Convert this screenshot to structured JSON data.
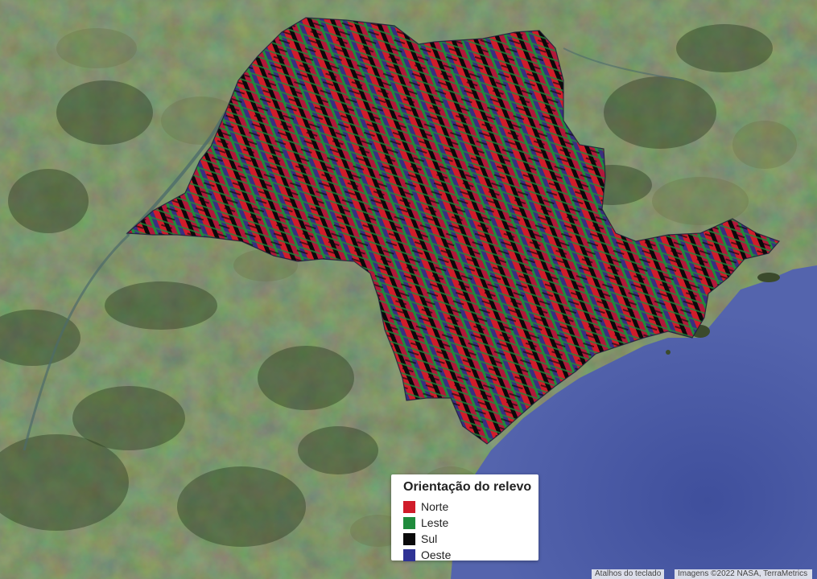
{
  "map": {
    "basemap": "satellite imagery",
    "overlay_colors": [
      "#d01c2a",
      "#1f8b3c",
      "#0a0a0a",
      "#2f3395"
    ],
    "ocean_color": "#4858a4"
  },
  "legend": {
    "title": "Orientação do relevo",
    "items": [
      {
        "label": "Norte",
        "color": "#d01c2a"
      },
      {
        "label": "Leste",
        "color": "#1f8b3c"
      },
      {
        "label": "Sul",
        "color": "#0a0a0a"
      },
      {
        "label": "Oeste",
        "color": "#2f3395"
      }
    ]
  },
  "attribution": {
    "keyboard_shortcuts": "Atalhos do teclado",
    "imagery": "Imagens ©2022 NASA, TerraMetrics"
  }
}
